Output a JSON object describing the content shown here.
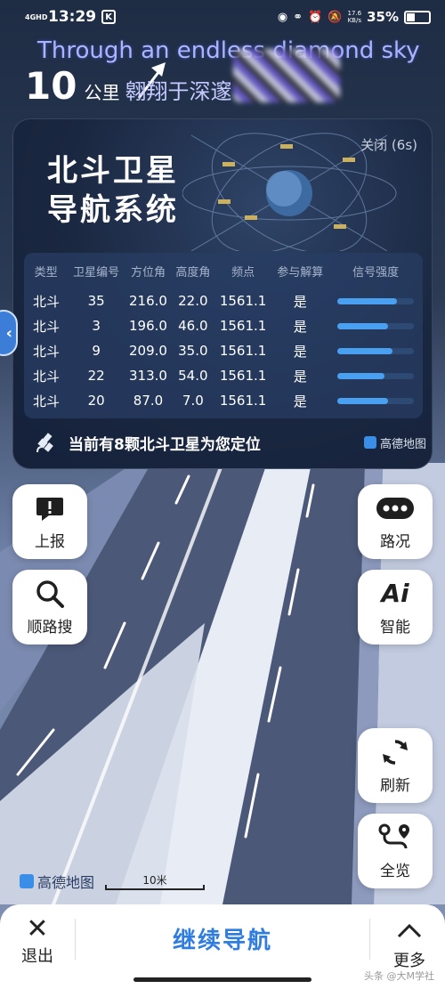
{
  "status_bar": {
    "network": "4GHD",
    "time": "13:29",
    "k_badge": "K",
    "speed": "17.6\nKB/s",
    "battery": "35%"
  },
  "lyric": "Through an endless diamond sky",
  "nav_header": {
    "distance": "10",
    "unit": "公里",
    "road": "翱翔于深邃"
  },
  "satellite_card": {
    "close_label": "关闭 (6s)",
    "title_line1": "北斗卫星",
    "title_line2": "导航系统",
    "columns": [
      "类型",
      "卫星编号",
      "方位角",
      "高度角",
      "频点",
      "参与解算",
      "信号强度"
    ],
    "rows": [
      {
        "type": "北斗",
        "id": "35",
        "azimuth": "216.0",
        "elevation": "22.0",
        "freq": "1561.1",
        "used": "是",
        "signal": 0.78
      },
      {
        "type": "北斗",
        "id": "3",
        "azimuth": "196.0",
        "elevation": "46.0",
        "freq": "1561.1",
        "used": "是",
        "signal": 0.66
      },
      {
        "type": "北斗",
        "id": "9",
        "azimuth": "209.0",
        "elevation": "35.0",
        "freq": "1561.1",
        "used": "是",
        "signal": 0.72
      },
      {
        "type": "北斗",
        "id": "22",
        "azimuth": "313.0",
        "elevation": "54.0",
        "freq": "1561.1",
        "used": "是",
        "signal": 0.62
      },
      {
        "type": "北斗",
        "id": "20",
        "azimuth": "87.0",
        "elevation": "7.0",
        "freq": "1561.1",
        "used": "是",
        "signal": 0.66
      }
    ],
    "footer_message": "当前有8颗北斗卫星为您定位",
    "brand": "高德地图"
  },
  "left_buttons": {
    "report": "上报",
    "search_along": "顺路搜"
  },
  "right_buttons": {
    "traffic": "路况",
    "ai": "智能",
    "refresh": "刷新",
    "overview": "全览"
  },
  "map": {
    "logo": "高德地图",
    "scale_label": "10米"
  },
  "bottom_bar": {
    "exit": "退出",
    "continue": "继续导航",
    "more": "更多",
    "watermark": "头条 @大M学社"
  },
  "colors": {
    "accent": "#2f7de1",
    "signal_bar": "#4aa0f0",
    "card_bg": "#1a2740"
  }
}
